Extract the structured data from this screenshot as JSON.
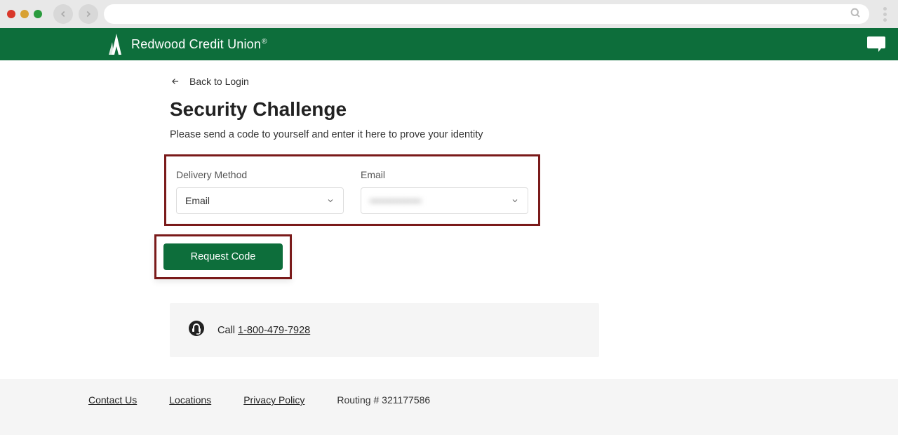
{
  "browser": {
    "url": ""
  },
  "header": {
    "brand": "Redwood Credit Union"
  },
  "nav": {
    "back_label": "Back to Login"
  },
  "page": {
    "title": "Security Challenge",
    "subtitle": "Please send a code to yourself and enter it here to prove your identity"
  },
  "form": {
    "delivery_label": "Delivery Method",
    "delivery_value": "Email",
    "destination_label": "Email",
    "destination_value": "•••••••••••••••",
    "request_button": "Request Code"
  },
  "help": {
    "call_prefix": "Call ",
    "phone": "1-800-479-7928"
  },
  "footer": {
    "contact": "Contact Us",
    "locations": "Locations",
    "privacy": "Privacy Policy",
    "routing_label": "Routing # ",
    "routing_number": "321177586"
  }
}
